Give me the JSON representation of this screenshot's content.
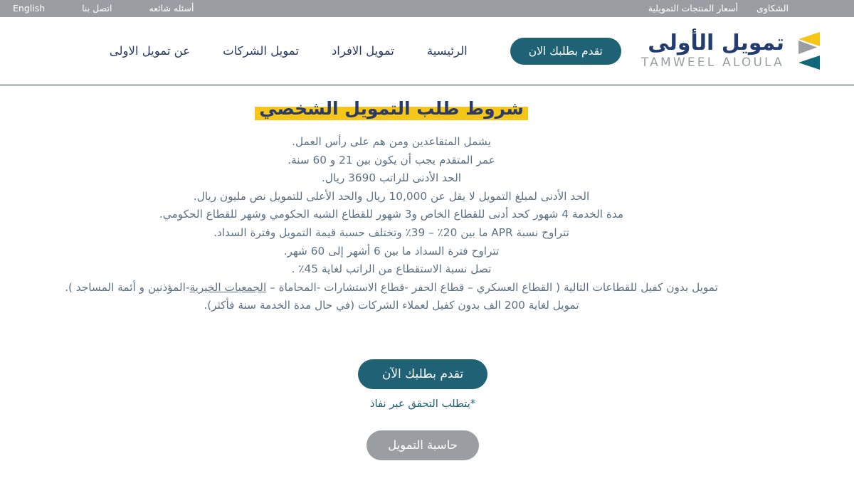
{
  "topbar": {
    "right_items": [
      {
        "label": "الشكاوى",
        "name": "complaints"
      },
      {
        "label": "أسعار المنتجات التمويلية",
        "name": "product-rates"
      }
    ],
    "left_items": [
      {
        "label": "أسئله شائعه",
        "name": "faq"
      },
      {
        "label": "اتصل بنا",
        "name": "contact-us"
      },
      {
        "label": "English",
        "name": "language-english"
      }
    ],
    "background": "#9a9ea3"
  },
  "header": {
    "brand": {
      "arabic": "تمويل الأولى",
      "latin": "TAMWEEL ALOULA",
      "mark_colors": {
        "top": "#f5c518",
        "middle": "#9a9ea3",
        "bottom": "#12687a"
      },
      "arabic_color": "#223b70",
      "latin_color": "#9a9ea3"
    },
    "cta_label": "تقدم بطلبك الان",
    "cta_color": "#1f6175",
    "nav_items": [
      {
        "label": "الرئيسية",
        "name": "home"
      },
      {
        "label": "تمويل الافراد",
        "name": "personal-finance"
      },
      {
        "label": "تمويل الشركات",
        "name": "corporate-finance"
      },
      {
        "label": "عن تمويل الاولى",
        "name": "about"
      }
    ],
    "border_color": "#10401a"
  },
  "main": {
    "page_title": "شروط طلب التمويل الشخصي",
    "title_highlight": "#f5c518",
    "title_color": "#2a3a6b",
    "terms": [
      "يشمل المتقاعدين ومن هم على رأس العمل.",
      "عمر المتقدم يجب أن يكون بين 21 و 60 سنة.",
      "الحد الأدنى للراتب 3690 ريال.",
      "الحد الأدنى لمبلغ التمويل لا يقل عن 10,000 ريال والحد الأعلى للتمويل نص مليون ريال.",
      "مدة الخدمة 4 شهور كحد أدنى للقطاع الخاص و3 شهور للقطاع الشبه الحكومي وشهر للقطاع الحكومي.",
      "تتراوح نسبة APR ما بين 20٪ – 39٪ وتختلف حسبة قيمة التمويل وفترة السداد.",
      "تتراوح فترة السداد ما بين 6 أشهر إلى 60 شهر.",
      "تصل نسبة الاستقطاع من الراتب لغاية 45٪ .",
      "تمويل لغاية 200 الف بدون كفيل لعملاء الشركات (في حال مدة الخدمة سنة فأكثر)."
    ],
    "sectors_line": {
      "before": "تمويل بدون كفيل للقطاعات التالية ( القطاع العسكري – قطاع الحفر -قطاع الاستشارات -المحاماة – ",
      "link": "الجمعيات الخيرية",
      "after": "-المؤذنين و أئمة المساجد )."
    }
  },
  "actions": {
    "apply_label": "تقدم بطلبك الآن",
    "apply_color": "#1f6175",
    "nafath_note": "*يتطلب التحقق عبر نفاذ",
    "nafath_color": "#1f6175",
    "calculator_label": "حاسبة التمويل",
    "calculator_color": "#9a9ea3"
  }
}
